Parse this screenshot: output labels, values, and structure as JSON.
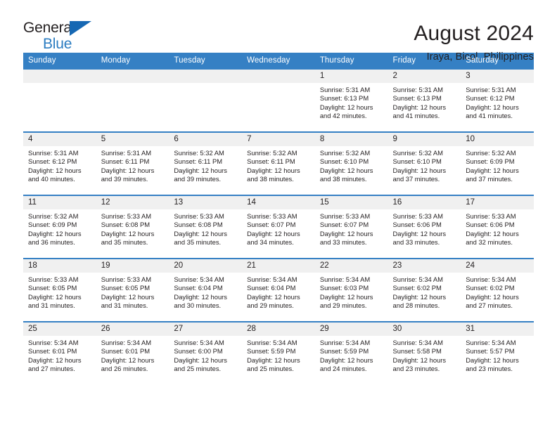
{
  "brand": {
    "name_part1": "General",
    "name_part2": "Blue",
    "accent_color": "#1668b3"
  },
  "header": {
    "title": "August 2024",
    "subtitle": "Iraya, Bicol, Philippines"
  },
  "theme": {
    "header_row_color": "#3580c4",
    "day_band_color": "#f0f0f0",
    "text_color": "#231f20"
  },
  "weekday_headers": [
    "Sunday",
    "Monday",
    "Tuesday",
    "Wednesday",
    "Thursday",
    "Friday",
    "Saturday"
  ],
  "labels": {
    "sunrise_prefix": "Sunrise:",
    "sunset_prefix": "Sunset:",
    "daylight_prefix": "Daylight:"
  },
  "weeks": [
    [
      {
        "day": "",
        "empty": true,
        "line1": "",
        "line2": "",
        "line3": "",
        "line4": ""
      },
      {
        "day": "",
        "empty": true,
        "line1": "",
        "line2": "",
        "line3": "",
        "line4": ""
      },
      {
        "day": "",
        "empty": true,
        "line1": "",
        "line2": "",
        "line3": "",
        "line4": ""
      },
      {
        "day": "",
        "empty": true,
        "line1": "",
        "line2": "",
        "line3": "",
        "line4": ""
      },
      {
        "day": "1",
        "empty": false,
        "line1": "Sunrise: 5:31 AM",
        "line2": "Sunset: 6:13 PM",
        "line3": "Daylight: 12 hours",
        "line4": "and 42 minutes."
      },
      {
        "day": "2",
        "empty": false,
        "line1": "Sunrise: 5:31 AM",
        "line2": "Sunset: 6:13 PM",
        "line3": "Daylight: 12 hours",
        "line4": "and 41 minutes."
      },
      {
        "day": "3",
        "empty": false,
        "line1": "Sunrise: 5:31 AM",
        "line2": "Sunset: 6:12 PM",
        "line3": "Daylight: 12 hours",
        "line4": "and 41 minutes."
      }
    ],
    [
      {
        "day": "4",
        "empty": false,
        "line1": "Sunrise: 5:31 AM",
        "line2": "Sunset: 6:12 PM",
        "line3": "Daylight: 12 hours",
        "line4": "and 40 minutes."
      },
      {
        "day": "5",
        "empty": false,
        "line1": "Sunrise: 5:31 AM",
        "line2": "Sunset: 6:11 PM",
        "line3": "Daylight: 12 hours",
        "line4": "and 39 minutes."
      },
      {
        "day": "6",
        "empty": false,
        "line1": "Sunrise: 5:32 AM",
        "line2": "Sunset: 6:11 PM",
        "line3": "Daylight: 12 hours",
        "line4": "and 39 minutes."
      },
      {
        "day": "7",
        "empty": false,
        "line1": "Sunrise: 5:32 AM",
        "line2": "Sunset: 6:11 PM",
        "line3": "Daylight: 12 hours",
        "line4": "and 38 minutes."
      },
      {
        "day": "8",
        "empty": false,
        "line1": "Sunrise: 5:32 AM",
        "line2": "Sunset: 6:10 PM",
        "line3": "Daylight: 12 hours",
        "line4": "and 38 minutes."
      },
      {
        "day": "9",
        "empty": false,
        "line1": "Sunrise: 5:32 AM",
        "line2": "Sunset: 6:10 PM",
        "line3": "Daylight: 12 hours",
        "line4": "and 37 minutes."
      },
      {
        "day": "10",
        "empty": false,
        "line1": "Sunrise: 5:32 AM",
        "line2": "Sunset: 6:09 PM",
        "line3": "Daylight: 12 hours",
        "line4": "and 37 minutes."
      }
    ],
    [
      {
        "day": "11",
        "empty": false,
        "line1": "Sunrise: 5:32 AM",
        "line2": "Sunset: 6:09 PM",
        "line3": "Daylight: 12 hours",
        "line4": "and 36 minutes."
      },
      {
        "day": "12",
        "empty": false,
        "line1": "Sunrise: 5:33 AM",
        "line2": "Sunset: 6:08 PM",
        "line3": "Daylight: 12 hours",
        "line4": "and 35 minutes."
      },
      {
        "day": "13",
        "empty": false,
        "line1": "Sunrise: 5:33 AM",
        "line2": "Sunset: 6:08 PM",
        "line3": "Daylight: 12 hours",
        "line4": "and 35 minutes."
      },
      {
        "day": "14",
        "empty": false,
        "line1": "Sunrise: 5:33 AM",
        "line2": "Sunset: 6:07 PM",
        "line3": "Daylight: 12 hours",
        "line4": "and 34 minutes."
      },
      {
        "day": "15",
        "empty": false,
        "line1": "Sunrise: 5:33 AM",
        "line2": "Sunset: 6:07 PM",
        "line3": "Daylight: 12 hours",
        "line4": "and 33 minutes."
      },
      {
        "day": "16",
        "empty": false,
        "line1": "Sunrise: 5:33 AM",
        "line2": "Sunset: 6:06 PM",
        "line3": "Daylight: 12 hours",
        "line4": "and 33 minutes."
      },
      {
        "day": "17",
        "empty": false,
        "line1": "Sunrise: 5:33 AM",
        "line2": "Sunset: 6:06 PM",
        "line3": "Daylight: 12 hours",
        "line4": "and 32 minutes."
      }
    ],
    [
      {
        "day": "18",
        "empty": false,
        "line1": "Sunrise: 5:33 AM",
        "line2": "Sunset: 6:05 PM",
        "line3": "Daylight: 12 hours",
        "line4": "and 31 minutes."
      },
      {
        "day": "19",
        "empty": false,
        "line1": "Sunrise: 5:33 AM",
        "line2": "Sunset: 6:05 PM",
        "line3": "Daylight: 12 hours",
        "line4": "and 31 minutes."
      },
      {
        "day": "20",
        "empty": false,
        "line1": "Sunrise: 5:34 AM",
        "line2": "Sunset: 6:04 PM",
        "line3": "Daylight: 12 hours",
        "line4": "and 30 minutes."
      },
      {
        "day": "21",
        "empty": false,
        "line1": "Sunrise: 5:34 AM",
        "line2": "Sunset: 6:04 PM",
        "line3": "Daylight: 12 hours",
        "line4": "and 29 minutes."
      },
      {
        "day": "22",
        "empty": false,
        "line1": "Sunrise: 5:34 AM",
        "line2": "Sunset: 6:03 PM",
        "line3": "Daylight: 12 hours",
        "line4": "and 29 minutes."
      },
      {
        "day": "23",
        "empty": false,
        "line1": "Sunrise: 5:34 AM",
        "line2": "Sunset: 6:02 PM",
        "line3": "Daylight: 12 hours",
        "line4": "and 28 minutes."
      },
      {
        "day": "24",
        "empty": false,
        "line1": "Sunrise: 5:34 AM",
        "line2": "Sunset: 6:02 PM",
        "line3": "Daylight: 12 hours",
        "line4": "and 27 minutes."
      }
    ],
    [
      {
        "day": "25",
        "empty": false,
        "line1": "Sunrise: 5:34 AM",
        "line2": "Sunset: 6:01 PM",
        "line3": "Daylight: 12 hours",
        "line4": "and 27 minutes."
      },
      {
        "day": "26",
        "empty": false,
        "line1": "Sunrise: 5:34 AM",
        "line2": "Sunset: 6:01 PM",
        "line3": "Daylight: 12 hours",
        "line4": "and 26 minutes."
      },
      {
        "day": "27",
        "empty": false,
        "line1": "Sunrise: 5:34 AM",
        "line2": "Sunset: 6:00 PM",
        "line3": "Daylight: 12 hours",
        "line4": "and 25 minutes."
      },
      {
        "day": "28",
        "empty": false,
        "line1": "Sunrise: 5:34 AM",
        "line2": "Sunset: 5:59 PM",
        "line3": "Daylight: 12 hours",
        "line4": "and 25 minutes."
      },
      {
        "day": "29",
        "empty": false,
        "line1": "Sunrise: 5:34 AM",
        "line2": "Sunset: 5:59 PM",
        "line3": "Daylight: 12 hours",
        "line4": "and 24 minutes."
      },
      {
        "day": "30",
        "empty": false,
        "line1": "Sunrise: 5:34 AM",
        "line2": "Sunset: 5:58 PM",
        "line3": "Daylight: 12 hours",
        "line4": "and 23 minutes."
      },
      {
        "day": "31",
        "empty": false,
        "line1": "Sunrise: 5:34 AM",
        "line2": "Sunset: 5:57 PM",
        "line3": "Daylight: 12 hours",
        "line4": "and 23 minutes."
      }
    ]
  ]
}
